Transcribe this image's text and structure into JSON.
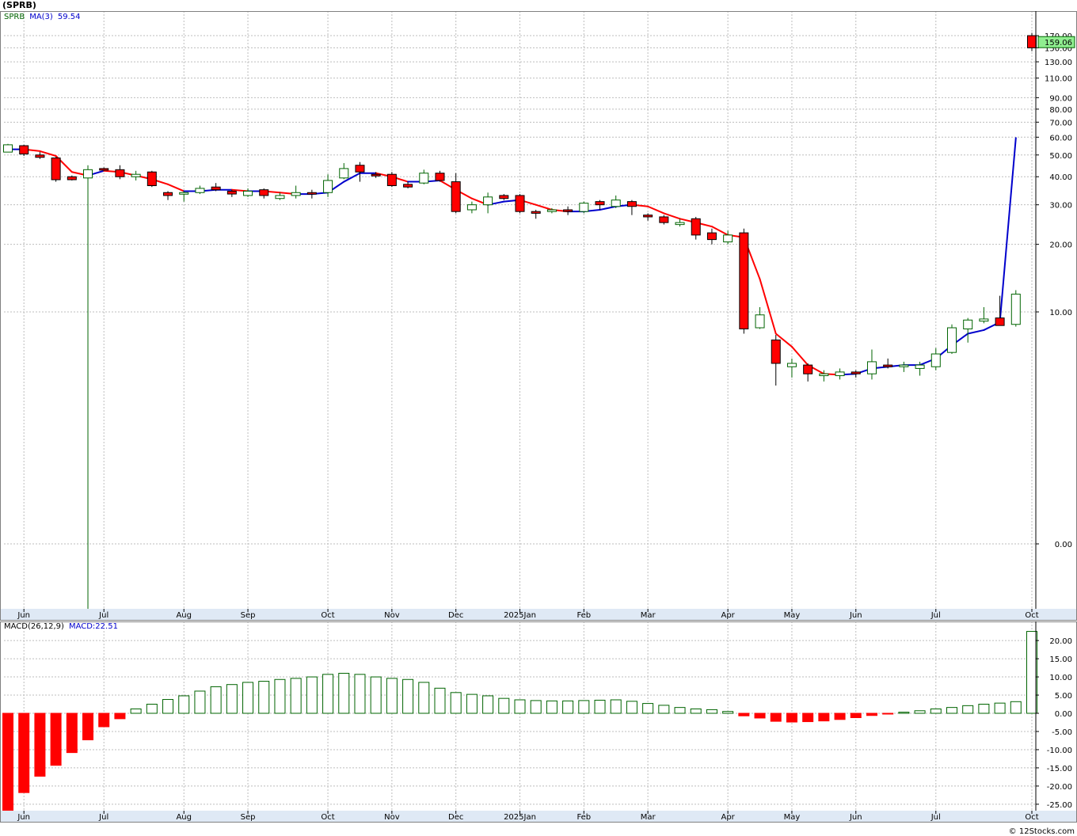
{
  "title": "(SPRB)",
  "legend_price": {
    "symbol": "SPRB",
    "ma_label": "MA(3)",
    "ma_value": "59.54"
  },
  "legend_macd": {
    "label": "MACD(26,12,9)",
    "value": "MACD:22.51"
  },
  "last_price_label": "159.06",
  "credit": "© 12Stocks.com",
  "colors": {
    "up": "#006400",
    "down": "#ff0000",
    "ma_up": "#0000cc",
    "ma_down": "#ff0000",
    "last_price_bg": "#90ee90"
  },
  "chart_data": [
    {
      "type": "candlestick",
      "name": "SPRB",
      "scale": "log",
      "ylim": [
        0.1,
        200
      ],
      "grid": true,
      "y_ticks": [
        0.0,
        10.0,
        20.0,
        30.0,
        40.0,
        50.0,
        60.0,
        70.0,
        80.0,
        90.0,
        110.0,
        130.0,
        150.0,
        170.0
      ],
      "y_tick_labels": [
        "0.00",
        "10.00",
        "20.00",
        "30.00",
        "40.00",
        "50.00",
        "60.00",
        "70.00",
        "80.00",
        "90.00",
        "110.00",
        "130.00",
        "150.00",
        "170.00"
      ],
      "x_tick_labels": [
        "Jun",
        "Jul",
        "Aug",
        "Sep",
        "Oct",
        "Nov",
        "Dec",
        "2025Jan",
        "Feb",
        "Mar",
        "Apr",
        "May",
        "Jun",
        "Jul",
        "Oct"
      ],
      "candles": [
        {
          "o": 51.5,
          "h": 56,
          "l": 51.5,
          "c": 55.5
        },
        {
          "o": 55,
          "h": 55.5,
          "l": 49.5,
          "c": 50.5
        },
        {
          "o": 50,
          "h": 51.5,
          "l": 48,
          "c": 48.8
        },
        {
          "o": 48.5,
          "h": 49,
          "l": 38,
          "c": 38.8
        },
        {
          "o": 40,
          "h": 40.5,
          "l": 38.5,
          "c": 38.8
        },
        {
          "o": 39.5,
          "h": 45,
          "l": 0.1,
          "c": 43
        },
        {
          "o": 43.5,
          "h": 44,
          "l": 42.5,
          "c": 43
        },
        {
          "o": 43,
          "h": 45,
          "l": 39,
          "c": 40
        },
        {
          "o": 40,
          "h": 42.5,
          "l": 38.5,
          "c": 41
        },
        {
          "o": 42,
          "h": 42.5,
          "l": 36,
          "c": 36.5
        },
        {
          "o": 34,
          "h": 34.5,
          "l": 31.5,
          "c": 33
        },
        {
          "o": 33.5,
          "h": 34.5,
          "l": 31,
          "c": 34
        },
        {
          "o": 34,
          "h": 36.5,
          "l": 33.5,
          "c": 35.5
        },
        {
          "o": 36,
          "h": 37.5,
          "l": 34.5,
          "c": 35
        },
        {
          "o": 34.5,
          "h": 35,
          "l": 32.5,
          "c": 33.5
        },
        {
          "o": 33,
          "h": 35.5,
          "l": 32.5,
          "c": 34.5
        },
        {
          "o": 35,
          "h": 35.5,
          "l": 32,
          "c": 33
        },
        {
          "o": 32,
          "h": 34,
          "l": 31.5,
          "c": 33
        },
        {
          "o": 33,
          "h": 36.5,
          "l": 32,
          "c": 34
        },
        {
          "o": 34,
          "h": 35,
          "l": 32,
          "c": 33.5
        },
        {
          "o": 34,
          "h": 41,
          "l": 32.5,
          "c": 38.5
        },
        {
          "o": 39.5,
          "h": 46,
          "l": 39,
          "c": 43.5
        },
        {
          "o": 45,
          "h": 46.5,
          "l": 38,
          "c": 42
        },
        {
          "o": 41,
          "h": 42,
          "l": 39.5,
          "c": 40.5
        },
        {
          "o": 41,
          "h": 42,
          "l": 36,
          "c": 36.5
        },
        {
          "o": 37,
          "h": 38,
          "l": 35.5,
          "c": 36
        },
        {
          "o": 37.5,
          "h": 43,
          "l": 37,
          "c": 41.5
        },
        {
          "o": 41.5,
          "h": 42.5,
          "l": 38,
          "c": 38.5
        },
        {
          "o": 38,
          "h": 41.5,
          "l": 27.5,
          "c": 28
        },
        {
          "o": 28.5,
          "h": 31,
          "l": 27.5,
          "c": 30
        },
        {
          "o": 30,
          "h": 34,
          "l": 27.5,
          "c": 32.5
        },
        {
          "o": 33,
          "h": 33.5,
          "l": 31.5,
          "c": 32
        },
        {
          "o": 33,
          "h": 33.5,
          "l": 27.5,
          "c": 28
        },
        {
          "o": 28,
          "h": 28.5,
          "l": 26,
          "c": 27.5
        },
        {
          "o": 28,
          "h": 29,
          "l": 27.5,
          "c": 28.5
        },
        {
          "o": 28.5,
          "h": 29.5,
          "l": 27,
          "c": 28
        },
        {
          "o": 28,
          "h": 31,
          "l": 27.5,
          "c": 30.5
        },
        {
          "o": 31,
          "h": 31.5,
          "l": 28.5,
          "c": 30
        },
        {
          "o": 29.5,
          "h": 33,
          "l": 29,
          "c": 31.5
        },
        {
          "o": 31,
          "h": 31.5,
          "l": 27,
          "c": 29.5
        },
        {
          "o": 27,
          "h": 27.5,
          "l": 25.5,
          "c": 26.5
        },
        {
          "o": 26.5,
          "h": 27,
          "l": 24.5,
          "c": 25
        },
        {
          "o": 24.5,
          "h": 26,
          "l": 24,
          "c": 25
        },
        {
          "o": 26,
          "h": 26.5,
          "l": 21,
          "c": 22
        },
        {
          "o": 22.5,
          "h": 23.5,
          "l": 20,
          "c": 21
        },
        {
          "o": 20.5,
          "h": 23,
          "l": 20,
          "c": 22
        },
        {
          "o": 22.5,
          "h": 23.5,
          "l": 8,
          "c": 8.4
        },
        {
          "o": 8.5,
          "h": 10.5,
          "l": 8.4,
          "c": 9.7
        },
        {
          "o": 7.5,
          "h": 7.9,
          "l": 4.7,
          "c": 5.9
        },
        {
          "o": 5.7,
          "h": 6.2,
          "l": 5.1,
          "c": 5.9
        },
        {
          "o": 5.8,
          "h": 5.9,
          "l": 4.9,
          "c": 5.3
        },
        {
          "o": 5.2,
          "h": 5.5,
          "l": 4.9,
          "c": 5.3
        },
        {
          "o": 5.2,
          "h": 5.6,
          "l": 5.0,
          "c": 5.4
        },
        {
          "o": 5.4,
          "h": 5.5,
          "l": 5.1,
          "c": 5.3
        },
        {
          "o": 5.3,
          "h": 6.8,
          "l": 5.0,
          "c": 6.0
        },
        {
          "o": 5.8,
          "h": 6.2,
          "l": 5.6,
          "c": 5.7
        },
        {
          "o": 5.7,
          "h": 6.0,
          "l": 5.4,
          "c": 5.8
        },
        {
          "o": 5.6,
          "h": 6.0,
          "l": 5.2,
          "c": 5.8
        },
        {
          "o": 5.7,
          "h": 6.9,
          "l": 5.5,
          "c": 6.5
        },
        {
          "o": 6.6,
          "h": 8.8,
          "l": 6.5,
          "c": 8.5
        },
        {
          "o": 8.4,
          "h": 9.4,
          "l": 7.3,
          "c": 9.2
        },
        {
          "o": 9.1,
          "h": 10.5,
          "l": 8.9,
          "c": 9.3
        },
        {
          "o": 9.4,
          "h": 11.8,
          "l": 8.9,
          "c": 8.7
        },
        {
          "o": 8.8,
          "h": 12.5,
          "l": 8.6,
          "c": 12.0
        },
        {
          "o": 170,
          "h": 175,
          "l": 145,
          "c": 150
        }
      ],
      "ma": [
        53,
        53,
        52,
        49.5,
        42,
        40.5,
        42.5,
        42,
        40.5,
        39,
        37,
        34.5,
        34.5,
        35,
        35,
        34.5,
        34.5,
        34,
        33.5,
        33.5,
        34,
        38,
        41.5,
        41.5,
        40,
        38,
        38,
        38.5,
        35,
        32,
        30,
        31,
        31.5,
        30,
        28.5,
        28,
        28,
        28.5,
        29.5,
        30,
        29.5,
        27.5,
        26,
        25,
        24,
        22,
        21.5,
        14,
        8,
        7,
        5.8,
        5.3,
        5.25,
        5.3,
        5.6,
        5.7,
        5.8,
        5.8,
        6.2,
        7.1,
        8.0,
        8.3,
        9.0,
        59.54
      ],
      "ma_last_value": 59.54,
      "last_price": 159.06
    },
    {
      "type": "bar",
      "name": "MACD(26,12,9)",
      "ylim": [
        -27,
        24
      ],
      "grid": true,
      "y_ticks": [
        -25,
        -20,
        -15,
        -10,
        -5,
        0,
        5,
        10,
        15,
        20
      ],
      "y_tick_labels": [
        "-25.00",
        "-20.00",
        "-15.00",
        "-10.00",
        "-5.00",
        "0.00",
        "5.00",
        "10.00",
        "15.00",
        "20.00"
      ],
      "x_tick_labels": [
        "Jun",
        "Jul",
        "Aug",
        "Sep",
        "Oct",
        "Nov",
        "Dec",
        "2025Jan",
        "Feb",
        "Mar",
        "Apr",
        "May",
        "Jun",
        "Jul",
        "Oct"
      ],
      "values": [
        -27,
        -21.8,
        -17.3,
        -14.3,
        -10.8,
        -7.3,
        -3.7,
        -1.5,
        1.2,
        2.5,
        3.8,
        4.8,
        6.1,
        7.3,
        7.9,
        8.5,
        8.8,
        9.3,
        9.6,
        10.0,
        10.7,
        11.0,
        10.7,
        10.0,
        9.6,
        9.3,
        8.5,
        6.9,
        5.7,
        5.2,
        4.8,
        4.1,
        3.7,
        3.5,
        3.4,
        3.4,
        3.5,
        3.6,
        3.7,
        3.3,
        2.7,
        2.2,
        1.6,
        1.2,
        1.0,
        0.5,
        -0.7,
        -1.3,
        -2.2,
        -2.4,
        -2.3,
        -2.1,
        -1.7,
        -1.2,
        -0.6,
        -0.2,
        0.3,
        0.7,
        1.2,
        1.6,
        2.1,
        2.5,
        2.8,
        3.2,
        22.51
      ]
    }
  ]
}
